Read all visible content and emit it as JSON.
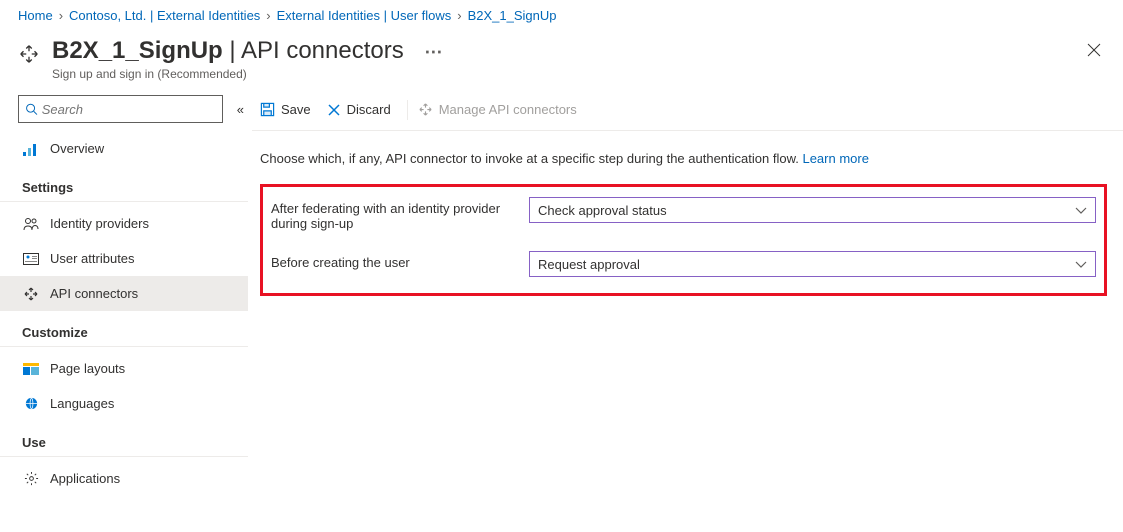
{
  "breadcrumb": {
    "items": [
      {
        "label": "Home"
      },
      {
        "label": "Contoso, Ltd. | External Identities"
      },
      {
        "label": "External Identities | User flows"
      },
      {
        "label": "B2X_1_SignUp"
      }
    ]
  },
  "header": {
    "title_strong": "B2X_1_SignUp",
    "title_sep": " | ",
    "title_rest": "API connectors",
    "subtitle": "Sign up and sign in (Recommended)"
  },
  "search": {
    "placeholder": "Search"
  },
  "sidebar": {
    "overview": "Overview",
    "heading_settings": "Settings",
    "identity_providers": "Identity providers",
    "user_attributes": "User attributes",
    "api_connectors": "API connectors",
    "heading_customize": "Customize",
    "page_layouts": "Page layouts",
    "languages": "Languages",
    "heading_use": "Use",
    "applications": "Applications"
  },
  "toolbar": {
    "save": "Save",
    "discard": "Discard",
    "manage": "Manage API connectors"
  },
  "main": {
    "intro_text": "Choose which, if any, API connector to invoke at a specific step during the authentication flow. ",
    "learn_more": "Learn more",
    "fields": {
      "after_federating": {
        "label": "After federating with an identity provider during sign-up",
        "value": "Check approval status"
      },
      "before_creating": {
        "label": "Before creating the user",
        "value": "Request approval"
      }
    }
  }
}
